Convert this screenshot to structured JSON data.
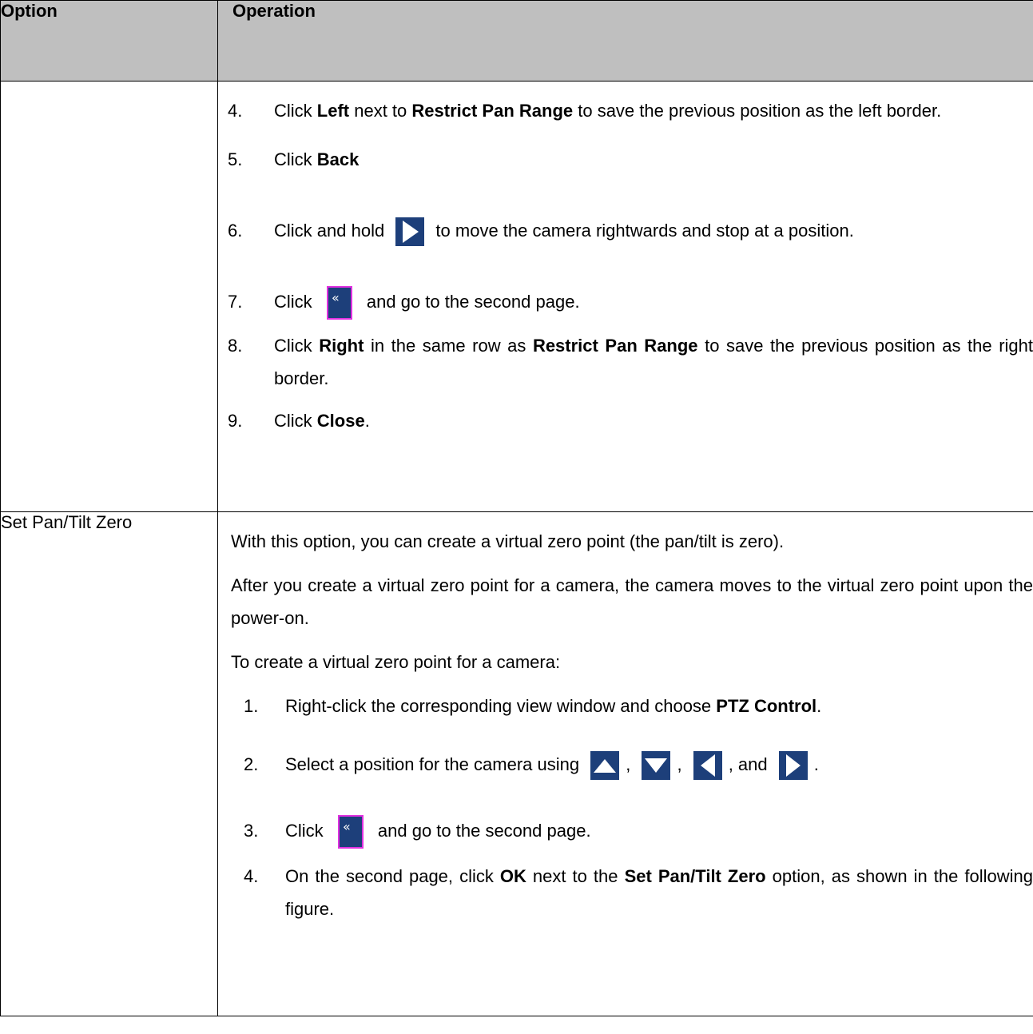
{
  "header": {
    "col_option": "Option",
    "col_operation": "Operation"
  },
  "row1": {
    "option": "",
    "steps": [
      {
        "num": "4.",
        "t1": "Click ",
        "b1": "Left",
        "t2": " next to ",
        "b2": "Restrict Pan Range",
        "t3": " to save the previous position as the left border."
      },
      {
        "num": "5.",
        "t1": "Click ",
        "b1": "Back"
      },
      {
        "num": "6.",
        "t1": "Click and hold ",
        "icon": "arrow-right-icon",
        "t2": " to move the camera rightwards and stop at a position."
      },
      {
        "num": "7.",
        "t1": "Click ",
        "icon": "double-chevron-left-icon",
        "t2": " and go to the second page."
      },
      {
        "num": "8.",
        "t1": "Click ",
        "b1": "Right",
        "t2": " in the same row as ",
        "b2": "Restrict Pan Range",
        "t3": " to save the previous position as the right border."
      },
      {
        "num": "9.",
        "t1": "Click ",
        "b1": "Close",
        "t2": "."
      }
    ]
  },
  "row2": {
    "option": "Set Pan/Tilt Zero",
    "para1": "With this option, you can create a virtual zero point (the pan/tilt is zero).",
    "para2": "After you create a virtual zero point for a camera, the camera moves to the virtual zero point upon the power-on.",
    "para3": "To create a virtual zero point for a camera:",
    "steps": [
      {
        "num": "1.",
        "t1": "Right-click the corresponding view window and choose ",
        "b1": "PTZ Control",
        "t2": "."
      },
      {
        "num": "2.",
        "t1": "Select a position for the camera using ",
        "sep1": ", ",
        "sep2": ", ",
        "sep3": ", and ",
        "end": ".",
        "icons": [
          "arrow-up-icon",
          "arrow-down-icon",
          "arrow-left-icon",
          "arrow-right-icon"
        ]
      },
      {
        "num": "3.",
        "t1": "Click ",
        "icon": "double-chevron-left-icon",
        "t2": " and go to the second page."
      },
      {
        "num": "4.",
        "t1": "On the second page, click ",
        "b1": "OK",
        "t2": " next to the ",
        "b2": "Set Pan/Tilt Zero",
        "t3": " option, as shown in the following figure."
      }
    ]
  },
  "colors": {
    "header_bg": "#bfbfbf",
    "icon_bg": "#1d3f7a",
    "icon_highlight": "#e030e0"
  }
}
